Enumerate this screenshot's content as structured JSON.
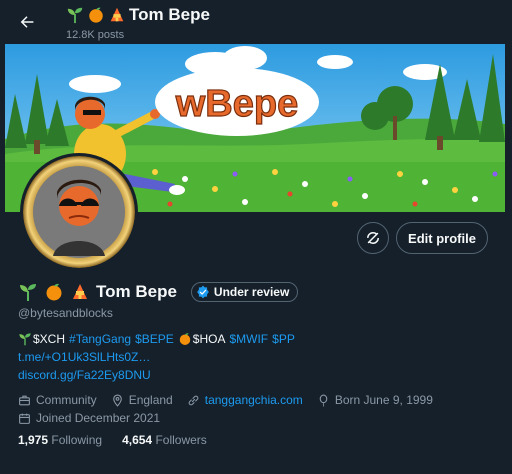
{
  "header": {
    "title": "Tom Bepe",
    "posts_count": "12.8K posts"
  },
  "banner": {
    "logo_text": "wBepe"
  },
  "actions": {
    "edit_profile": "Edit profile"
  },
  "profile": {
    "name": "Tom Bepe",
    "badge": "Under review",
    "handle": "@bytesandblocks",
    "bio": {
      "line1": {
        "t1": "$XCH",
        "t2": "#TangGang",
        "t3": "$BEPE",
        "t4": "$HOA",
        "t5": "$MWIF",
        "t6": "$PP"
      },
      "line2": "t.me/+O1Uk3SlLHts0Z…",
      "line3": "discord.gg/Fa22Ey8DNU"
    },
    "meta": {
      "category": "Community",
      "location": "England",
      "website": "tanggangchia.com",
      "born": "Born June 9, 1999",
      "joined": "Joined December 2021"
    },
    "stats": {
      "following_count": "1,975",
      "following_label": "Following",
      "followers_count": "4,654",
      "followers_label": "Followers"
    }
  },
  "colors": {
    "background": "#15202b",
    "link": "#1d9bf0",
    "secondary_text": "#8b98a5",
    "border": "#536471"
  }
}
